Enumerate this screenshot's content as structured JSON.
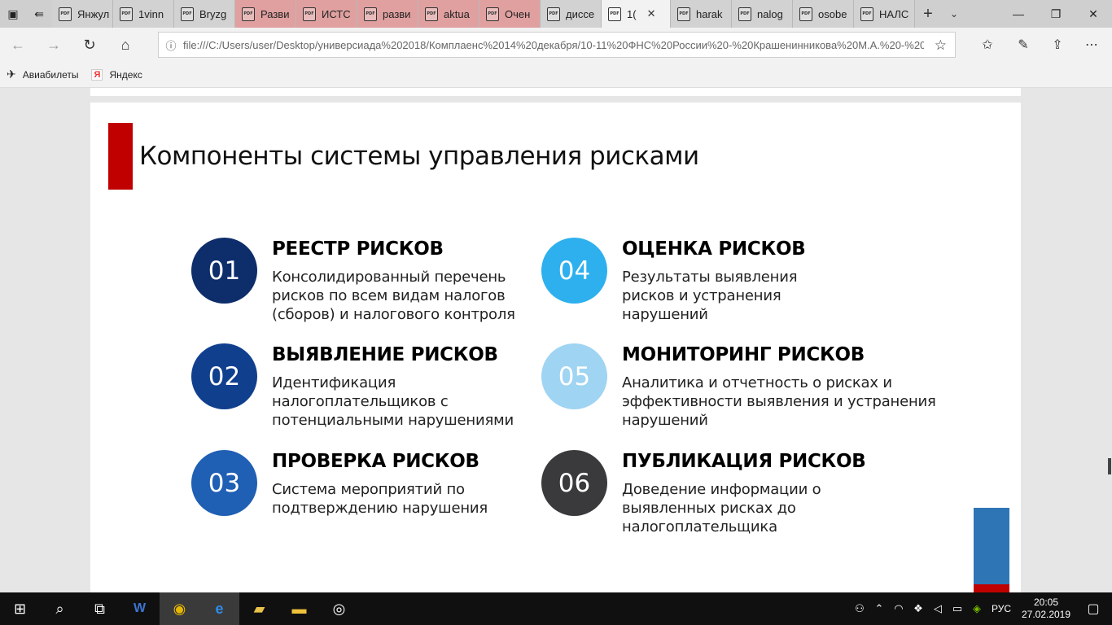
{
  "tabbar": {
    "tabs": [
      {
        "label": "Янжул"
      },
      {
        "label": "1vinn"
      },
      {
        "label": "Bryzg"
      },
      {
        "label": "Разви"
      },
      {
        "label": "ИСТС"
      },
      {
        "label": "разви"
      },
      {
        "label": "aktua"
      },
      {
        "label": "Очен"
      },
      {
        "label": "диссе"
      },
      {
        "label": "1("
      },
      {
        "label": "harak"
      },
      {
        "label": "nalog"
      },
      {
        "label": "osobe"
      },
      {
        "label": "НАЛС"
      }
    ],
    "new_tab_glyph": "+",
    "chevron_glyph": "⌄",
    "minimize_glyph": "—",
    "restore_glyph": "❐",
    "close_glyph": "✕",
    "tab_close_glyph": "✕",
    "pdf_glyph": "PDF"
  },
  "address_bar": {
    "url": "file:///C:/Users/user/Desktop/универсиада%202018/Комплаенс%2014%20декабря/10-11%20ФНС%20России%20-%20Крашенинникова%20М.А.%20-%20",
    "info_glyph": "ⓘ",
    "star_glyph": "☆"
  },
  "favorites": [
    {
      "label": "Авиабилеты",
      "icon": "airplane-icon"
    },
    {
      "label": "Яндекс",
      "icon": "yandex-icon",
      "glyph": "Я"
    }
  ],
  "slide": {
    "title": "Компоненты системы управления рисками",
    "items": [
      {
        "number": "01",
        "title": "РЕЕСТР РИСКОВ",
        "desc": [
          "Консолидированный перечень",
          "рисков по всем видам налогов",
          "(сборов) и налогового контроля"
        ],
        "color": "#0d2d6b"
      },
      {
        "number": "02",
        "title": "ВЫЯВЛЕНИЕ РИСКОВ",
        "desc": [
          "Идентификация",
          "налогоплательщиков с",
          "потенциальными нарушениями"
        ],
        "color": "#103f8e"
      },
      {
        "number": "03",
        "title": "ПРОВЕРКА РИСКОВ",
        "desc": [
          "Система мероприятий по",
          "подтверждению нарушения"
        ],
        "color": "#1f5fb4"
      },
      {
        "number": "04",
        "title": "ОЦЕНКА РИСКОВ",
        "desc": [
          "Результаты выявления",
          "рисков и устранения",
          "нарушений"
        ],
        "color": "#2eb0ee"
      },
      {
        "number": "05",
        "title": "МОНИТОРИНГ РИСКОВ",
        "desc": [
          "Аналитика и отчетность о рисках и",
          "эффективности выявления и устранения",
          "нарушений"
        ],
        "color": "#9fd4f2"
      },
      {
        "number": "06",
        "title": "ПУБЛИКАЦИЯ РИСКОВ",
        "desc": [
          "Доведение информации о",
          "выявленных рисках до",
          "налогоплательщика"
        ],
        "color": "#3a3a3c"
      }
    ]
  },
  "taskbar": {
    "lang": "РУС",
    "time": "20:05",
    "date": "27.02.2019"
  }
}
